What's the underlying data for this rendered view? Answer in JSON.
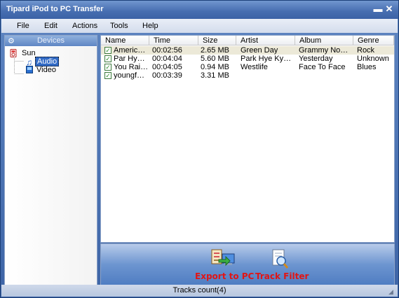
{
  "window": {
    "title": "Tipard iPod to PC Transfer",
    "minimize_glyph": "▬",
    "close_glyph": "✕"
  },
  "menu": {
    "items": [
      "File",
      "Edit",
      "Actions",
      "Tools",
      "Help"
    ]
  },
  "sidebar": {
    "header": "Devices",
    "device": "Sun",
    "children": [
      "Audio",
      "Video"
    ],
    "selected": "Audio"
  },
  "table": {
    "columns": [
      "Name",
      "Time",
      "Size",
      "Artist",
      "Album",
      "Genre"
    ],
    "rows": [
      {
        "name": "American ...",
        "time": "00:02:56",
        "size": "2.65 MB",
        "artist": "Green Day",
        "album": "Grammy Nomin...",
        "genre": "Rock",
        "checked": true,
        "selected": true
      },
      {
        "name": "Par Hye K...",
        "time": "00:04:04",
        "size": "5.60 MB",
        "artist": "Park Hye Kyoung",
        "album": "Yesterday",
        "genre": "Unknown",
        "checked": true,
        "selected": false
      },
      {
        "name": "You Raise...",
        "time": "00:04:05",
        "size": "0.94 MB",
        "artist": "Westlife",
        "album": "Face To Face",
        "genre": "Blues",
        "checked": true,
        "selected": false
      },
      {
        "name": "youngforyou",
        "time": "00:03:39",
        "size": "3.31 MB",
        "artist": "",
        "album": "",
        "genre": "",
        "checked": true,
        "selected": false
      }
    ]
  },
  "actions": {
    "export_label": "Export to PC",
    "filter_label": "Track Filter"
  },
  "status": {
    "text": "Tracks count(4)"
  },
  "colors": {
    "accent": "#3d64a6",
    "action_text": "#e11515"
  }
}
